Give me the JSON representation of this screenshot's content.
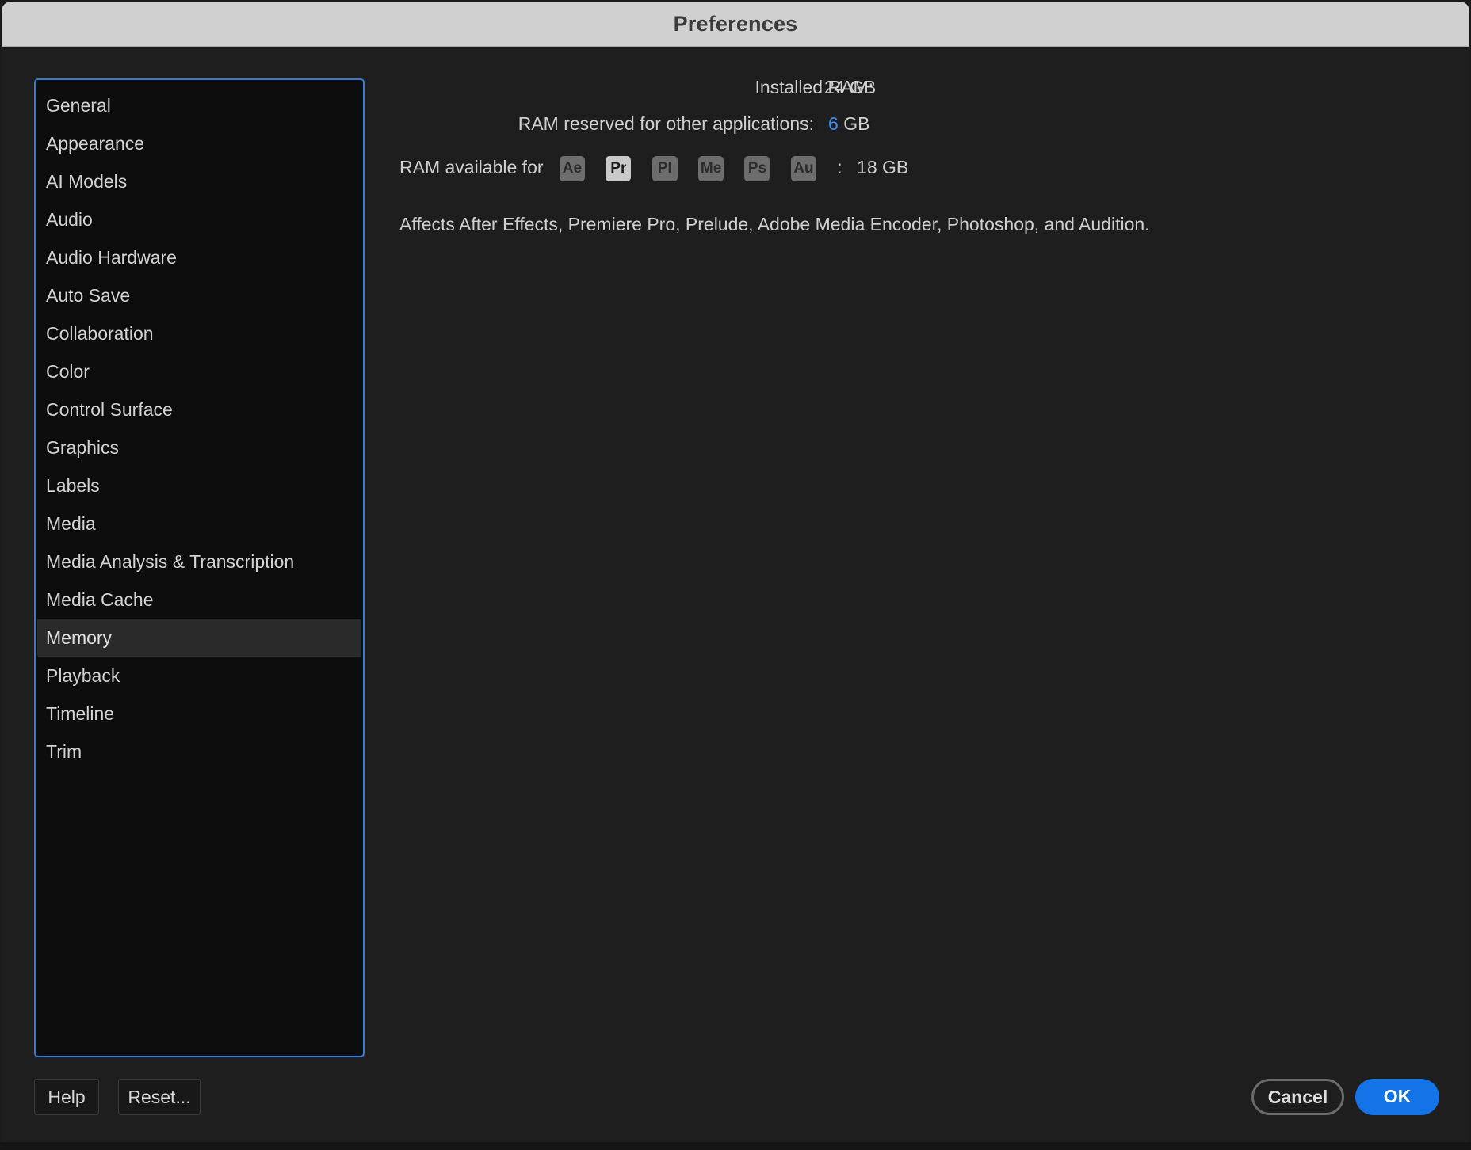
{
  "window": {
    "title": "Preferences"
  },
  "sidebar": {
    "items": [
      {
        "label": "General"
      },
      {
        "label": "Appearance"
      },
      {
        "label": "AI Models"
      },
      {
        "label": "Audio"
      },
      {
        "label": "Audio Hardware"
      },
      {
        "label": "Auto Save"
      },
      {
        "label": "Collaboration"
      },
      {
        "label": "Color"
      },
      {
        "label": "Control Surface"
      },
      {
        "label": "Graphics"
      },
      {
        "label": "Labels"
      },
      {
        "label": "Media"
      },
      {
        "label": "Media Analysis & Transcription"
      },
      {
        "label": "Media Cache"
      },
      {
        "label": "Memory",
        "selected": true
      },
      {
        "label": "Playback"
      },
      {
        "label": "Timeline"
      },
      {
        "label": "Trim"
      }
    ]
  },
  "memory": {
    "installed_ram_label": "Installed RAM:",
    "installed_ram_value": "24 GB",
    "reserved_label": "RAM reserved for other applications:",
    "reserved_value": "6",
    "reserved_unit": "GB",
    "available_label": "RAM available for",
    "apps": [
      {
        "abbr": "Ae",
        "active": false
      },
      {
        "abbr": "Pr",
        "active": true
      },
      {
        "abbr": "Pl",
        "active": false
      },
      {
        "abbr": "Me",
        "active": false
      },
      {
        "abbr": "Ps",
        "active": false
      },
      {
        "abbr": "Au",
        "active": false
      }
    ],
    "available_separator": ":",
    "available_value": "18 GB",
    "affects_note": "Affects After Effects, Premiere Pro, Prelude, Adobe Media Encoder, Photoshop, and Audition."
  },
  "footer": {
    "help_label": "Help",
    "reset_label": "Reset...",
    "cancel_label": "Cancel",
    "ok_label": "OK"
  },
  "colors": {
    "accent": "#3d8ef0",
    "primary_button": "#1473e6",
    "sidebar_border": "#2f7fd8"
  }
}
